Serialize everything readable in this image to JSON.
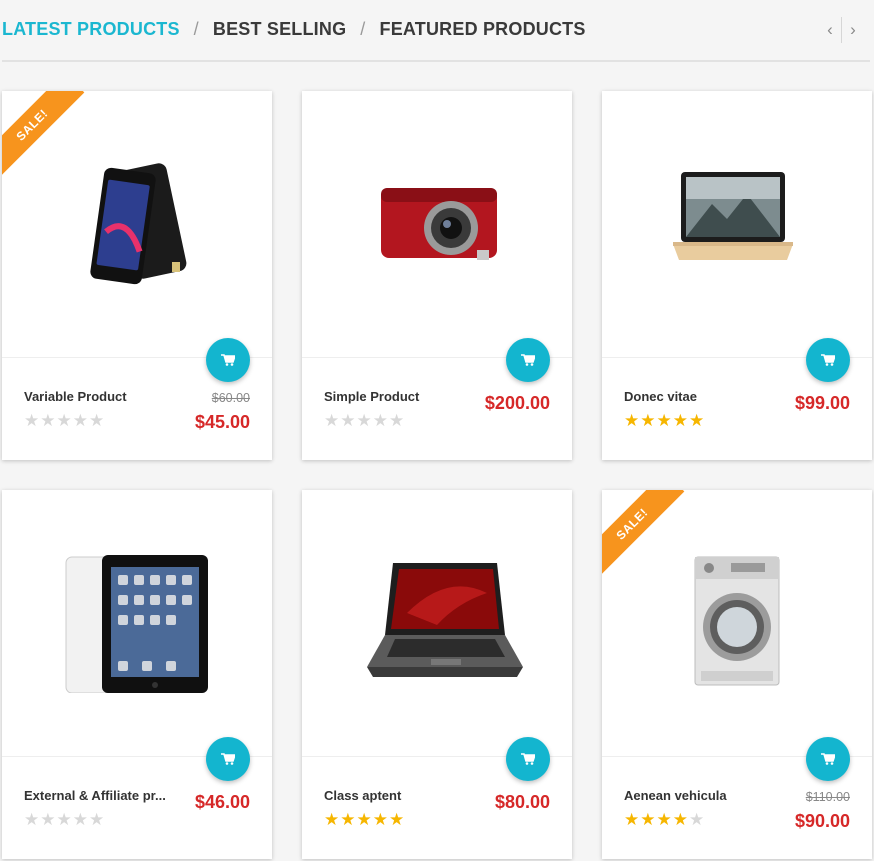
{
  "tabs": [
    {
      "label": "LATEST PRODUCTS"
    },
    {
      "label": "BEST SELLING"
    },
    {
      "label": "FEATURED PRODUCTS"
    }
  ],
  "separator": "/",
  "nav": {
    "prev": "‹",
    "next": "›"
  },
  "sale_label": "SALE!",
  "products": [
    {
      "name": "Variable Product",
      "old_price": "$60.00",
      "price": "$45.00",
      "rating": 0,
      "image": "smartphone"
    },
    {
      "name": "Simple Product",
      "old_price": "",
      "price": "$200.00",
      "rating": 0,
      "image": "camera"
    },
    {
      "name": "Donec vitae",
      "old_price": "",
      "price": "$99.00",
      "rating": 5,
      "image": "laptop"
    },
    {
      "name": "External & Affiliate pr...",
      "old_price": "",
      "price": "$46.00",
      "rating": 0,
      "image": "tablet"
    },
    {
      "name": "Class aptent",
      "old_price": "",
      "price": "$80.00",
      "rating": 5,
      "image": "notebook"
    },
    {
      "name": "Aenean vehicula",
      "old_price": "$110.00",
      "price": "$90.00",
      "rating": 4,
      "image": "washing-machine"
    }
  ],
  "colors": {
    "accent": "#1bb7d0",
    "price": "#d62828",
    "sale": "#f7941d",
    "star": "#f6b600"
  }
}
